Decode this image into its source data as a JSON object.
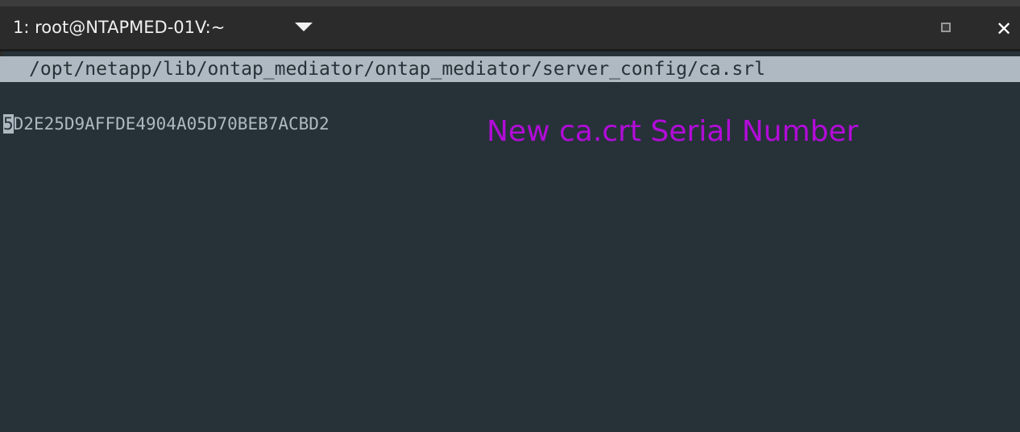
{
  "window": {
    "tab_title": "1: root@NTAPMED-01V:~",
    "close_symbol": "✕"
  },
  "terminal": {
    "path": "/opt/netapp/lib/ontap_mediator/ontap_mediator/server_config/ca.srl",
    "serial_first_char": "5",
    "serial_rest": "D2E25D9AFFDE4904A05D70BEB7ACBD2"
  },
  "annotation": {
    "text": "New ca.crt Serial Number",
    "color": "#b20cd8"
  },
  "colors": {
    "background": "#263238",
    "text": "#aeb9c1",
    "titlebar": "#2b2b2b"
  },
  "icons": [
    "chevron-down-icon",
    "maximize-icon",
    "close-icon"
  ]
}
